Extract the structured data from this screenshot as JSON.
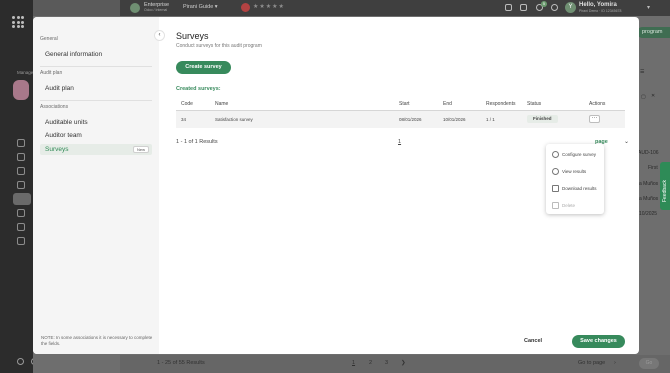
{
  "background": {
    "brand_name": "Enterprise",
    "brand_sub": "Odoo / Internal",
    "project": "Pirani Guide",
    "user_initial": "Y",
    "greeting": "Hello, Yomira",
    "user_sub": "Pirani Demo · ID 12345678",
    "notification_count": "5",
    "rail_label": "Manage",
    "top_pill": "program",
    "side_texts": [
      "AUD-106",
      "First",
      "a Muños",
      "a Muños",
      "10/2025"
    ],
    "pager_results": "1 - 25 of 55 Results",
    "pages": [
      "1",
      "2",
      "3"
    ],
    "go_to_page": "Go to page",
    "go_button": "Go",
    "feedback": "Feedback"
  },
  "sidebar": {
    "sections": [
      {
        "title": "General",
        "items": [
          {
            "label": "General information"
          }
        ]
      },
      {
        "title": "Audit plan",
        "items": [
          {
            "label": "Audit plan"
          }
        ]
      },
      {
        "title": "Associations",
        "items": [
          {
            "label": "Auditable units"
          },
          {
            "label": "Auditor team"
          },
          {
            "label": "Surveys",
            "badge": "New",
            "active": true
          }
        ]
      }
    ],
    "note": "NOTE: In some associations it is necessary to complete the fields."
  },
  "main": {
    "title": "Surveys",
    "subtitle": "Conduct surveys for this audit program",
    "create_button": "Create survey",
    "created_label": "Created surveys:",
    "columns": [
      "Code",
      "Name",
      "Start",
      "End",
      "Respondents",
      "Status",
      "Actions"
    ],
    "rows": [
      {
        "code": "34",
        "name": "Satisfaction survey",
        "start": "08/01/2026",
        "end": "10/01/2026",
        "respondents": "1 / 1",
        "status": "Finished",
        "actions": "···"
      }
    ],
    "results": "1 - 1 of 1 Results",
    "current_page": "1",
    "per_page": "page"
  },
  "actions_menu": {
    "items": [
      {
        "label": "Configure survey",
        "icon": "gear-icon",
        "disabled": false
      },
      {
        "label": "View results",
        "icon": "eye-icon",
        "disabled": false
      },
      {
        "label": "Download results",
        "icon": "download-icon",
        "disabled": false
      },
      {
        "label": "Delete",
        "icon": "trash-icon",
        "disabled": true
      }
    ]
  },
  "footer": {
    "cancel": "Cancel",
    "save": "Save changes"
  },
  "colors": {
    "accent": "#378a5c",
    "active_bg": "#e6ece7"
  }
}
